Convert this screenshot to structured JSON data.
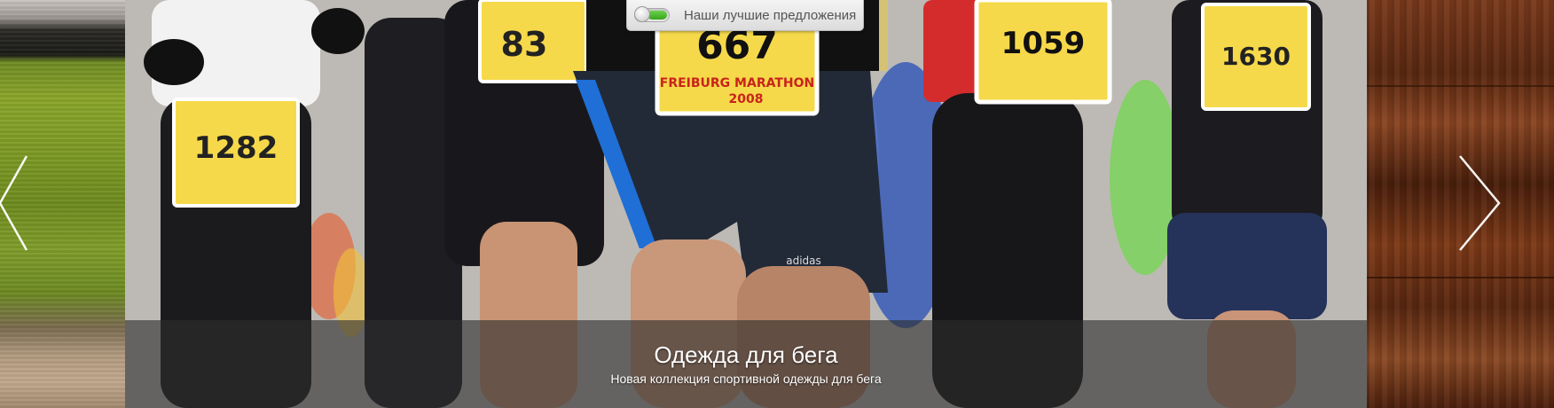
{
  "slider": {
    "offers_tab": {
      "label": "Наши лучшие предложения",
      "toggle_on": true,
      "toggle_color": "#3aa51e"
    },
    "current_slide": {
      "title": "Одежда для бега",
      "subtitle": "Новая коллекция спортивной одежды для бега",
      "photo_bibs": [
        "1282",
        "83",
        "667",
        "1059",
        "1630"
      ],
      "photo_bib_text": [
        "FREIBURG MARATHON",
        "2008"
      ],
      "photo_logo": "adidas"
    },
    "nav": {
      "prev_icon": "chevron-left-icon",
      "next_icon": "chevron-right-icon"
    },
    "colors": {
      "bib_yellow": "#f6d94a",
      "caption_band": "#2d2d2d",
      "wood": "#6a3015",
      "grass": "#7d9a25"
    }
  }
}
